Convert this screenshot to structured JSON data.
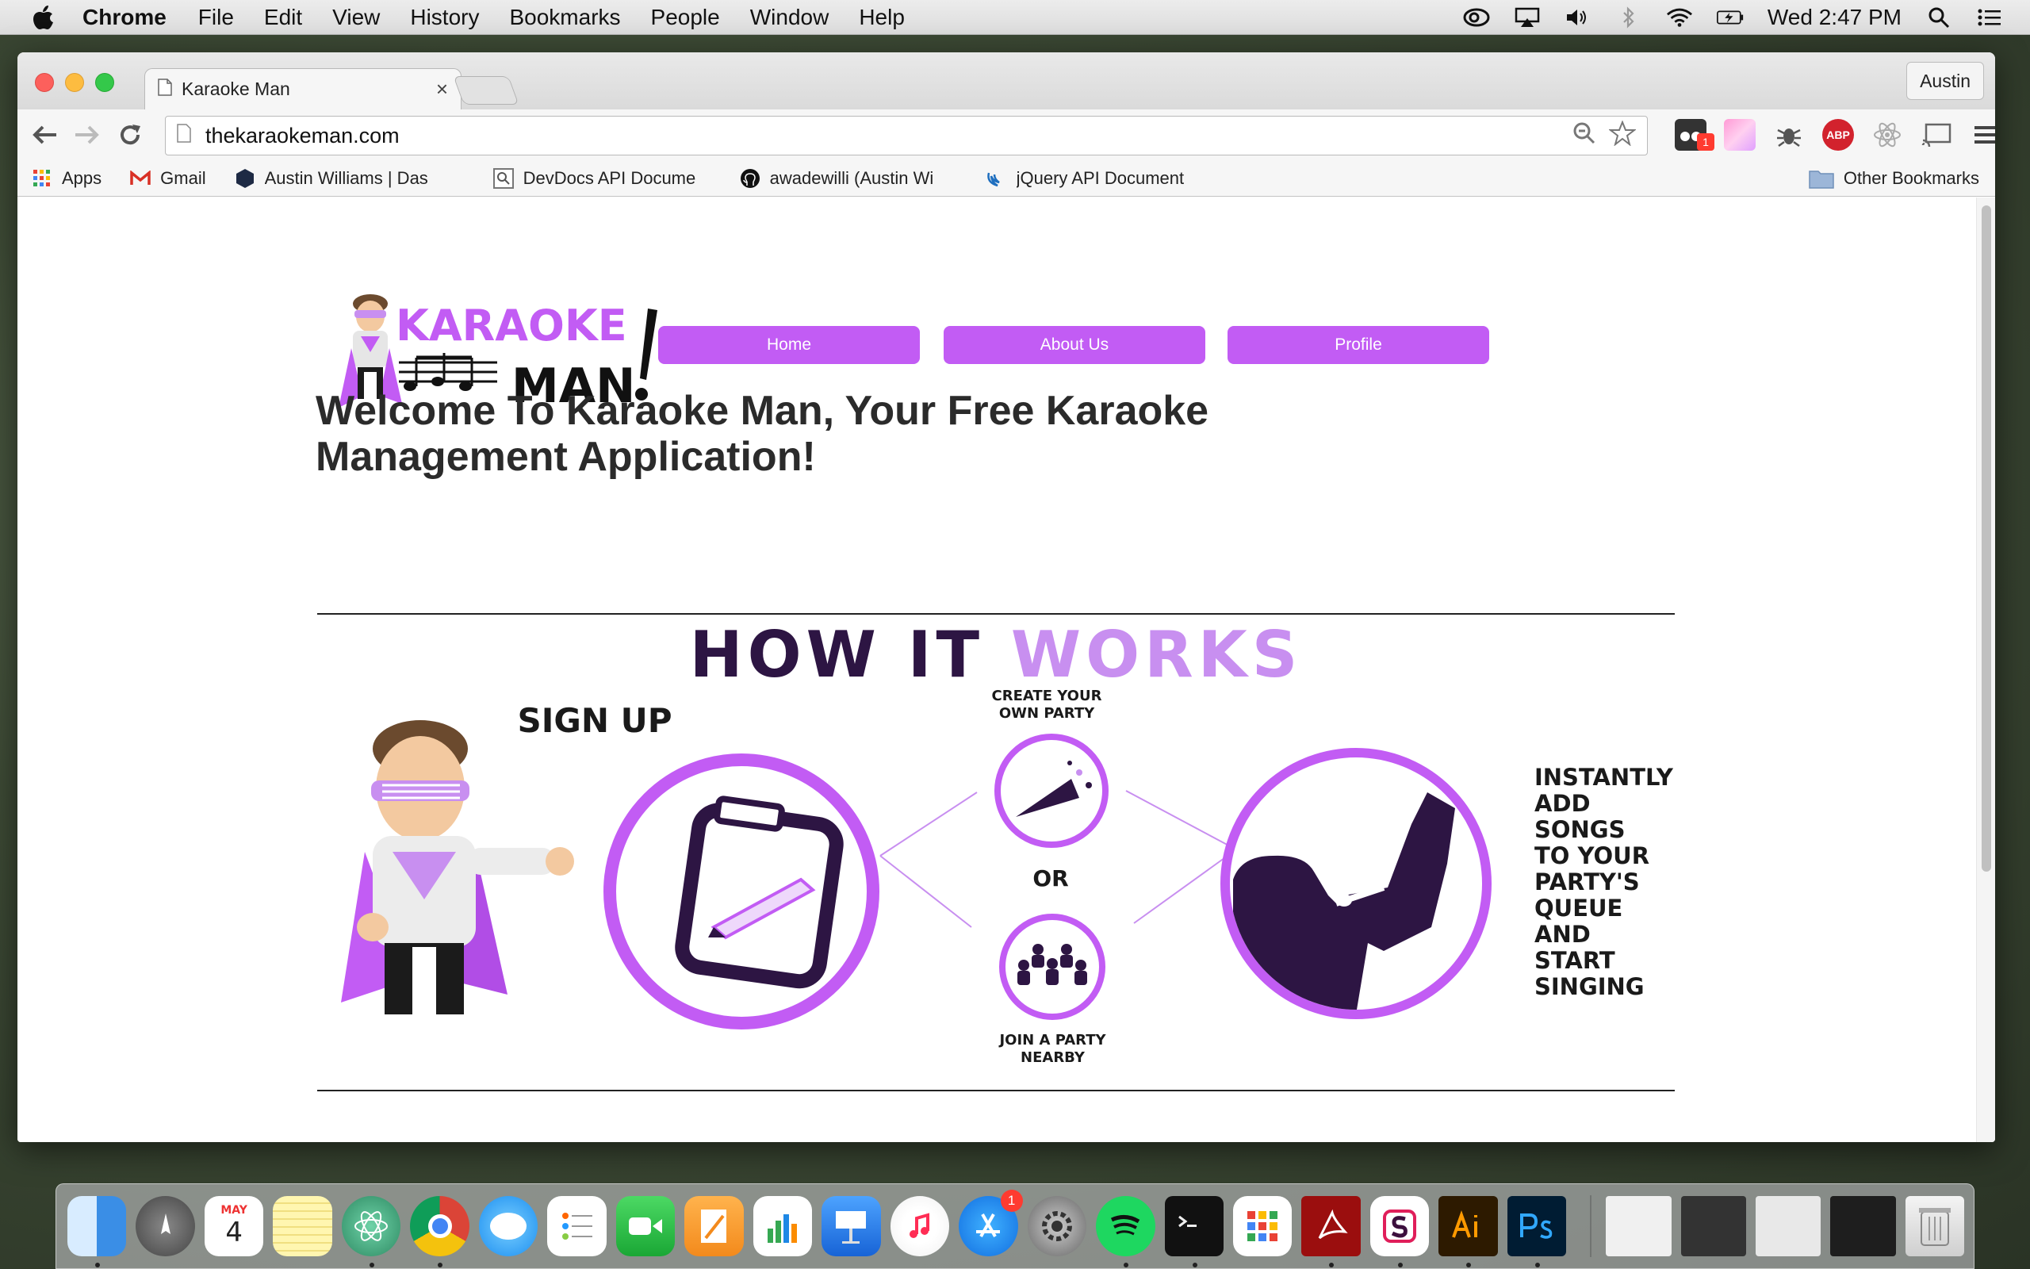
{
  "menubar": {
    "app_name": "Chrome",
    "menus": [
      "File",
      "Edit",
      "View",
      "History",
      "Bookmarks",
      "People",
      "Window",
      "Help"
    ],
    "clock": "Wed 2:47 PM"
  },
  "browser": {
    "tab_title": "Karaoke Man",
    "tab_close": "×",
    "profile_name": "Austin",
    "url": "thekaraokeman.com",
    "extensions": {
      "abp_label": "ABP",
      "badge_count": "1"
    },
    "bookmarks": [
      {
        "label": "Apps",
        "icon": "apps-grid-icon"
      },
      {
        "label": "Gmail",
        "icon": "gmail-icon"
      },
      {
        "label": "Austin Williams | Das",
        "icon": "hex-icon"
      },
      {
        "label": "DevDocs API Docume",
        "icon": "devdocs-icon"
      },
      {
        "label": "awadewilli (Austin Wi",
        "icon": "github-icon"
      },
      {
        "label": "jQuery API Document",
        "icon": "jquery-icon"
      }
    ],
    "other_bookmarks": "Other Bookmarks"
  },
  "page": {
    "logo": {
      "line1": "KARAOKE",
      "line2": "MAN"
    },
    "nav": [
      "Home",
      "About Us",
      "Profile"
    ],
    "headline": "Welcome To Karaoke Man, Your Free Karaoke Management Application!",
    "how_it_works": {
      "title_dark": "HOW IT",
      "title_accent": "WORKS",
      "step_signup": "SIGN UP",
      "create_party": "CREATE YOUR OWN PARTY",
      "or": "OR",
      "join_party": "JOIN A PARTY NEARBY",
      "final_step": [
        "INSTANTLY",
        "ADD SONGS",
        "TO YOUR",
        "PARTY'S",
        "QUEUE AND",
        "START",
        "SINGING"
      ]
    },
    "colors": {
      "accent": "#c25cf4",
      "accent_light": "#c88ff0",
      "dark_purple": "#2d1543"
    }
  },
  "dock": {
    "calendar_month": "MAY",
    "calendar_day": "4",
    "appstore_badge": "1",
    "apps": [
      "finder",
      "launchpad",
      "calendar",
      "notes",
      "atom",
      "chrome",
      "messages",
      "reminders",
      "facetime",
      "pages",
      "numbers",
      "keynote",
      "itunes",
      "app-store",
      "system-preferences",
      "spotify",
      "terminal",
      "launcher",
      "acrobat",
      "slack",
      "illustrator",
      "photoshop"
    ]
  }
}
